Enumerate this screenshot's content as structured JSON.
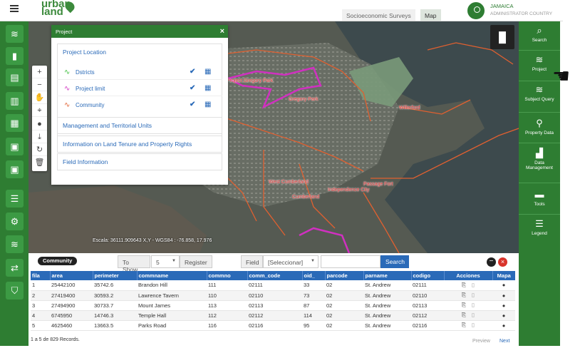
{
  "app": {
    "logo_line1": "urban",
    "logo_line2": "land"
  },
  "top_tabs": [
    {
      "label": "Socioeconomic Surveys"
    },
    {
      "label": "Map"
    }
  ],
  "user": {
    "country": "JAMAICA",
    "role": "ADMINISTRATOR COUNTRY"
  },
  "right_menu": [
    {
      "label": "Search",
      "icon": "search-icon"
    },
    {
      "label": "Project",
      "icon": "layers-icon"
    },
    {
      "label": "Subject Query",
      "icon": "layers-query-icon"
    },
    {
      "label": "Property Data",
      "icon": "pin-icon"
    },
    {
      "label": "Data Management",
      "icon": "bar-chart-icon"
    },
    {
      "label": "Tools",
      "icon": "toolbox-icon"
    },
    {
      "label": "Legend",
      "icon": "list-icon"
    }
  ],
  "project_panel": {
    "title": "Project",
    "section_location": "Project Location",
    "layers": [
      {
        "name": "Dstricts",
        "color": "#3bbf3b"
      },
      {
        "name": "Project limit",
        "color": "#d030c0"
      },
      {
        "name": "Community",
        "color": "#e06030"
      }
    ],
    "sections": [
      "Management and Territorial Units",
      "Information on Land Tenure and Property Rights",
      "Field Information"
    ]
  },
  "map": {
    "scale_text": "Escala: 36111.909643 X,Y - WGS84 : -76.858, 17.976",
    "labels": [
      "Project Gregory Park",
      "Gregory Park",
      "Willerford",
      "West Cumberland",
      "Cumberland",
      "Independence City",
      "Passage Fort"
    ]
  },
  "table_controls": {
    "badge": "Community",
    "to_show_label": "To Show",
    "to_show_value": "5",
    "register_label": "Register",
    "field_label": "Field",
    "field_value": "[Seleccionar]",
    "search_placeholder": "",
    "search_button": "Search"
  },
  "table": {
    "headers": [
      "fila",
      "area",
      "perimeter",
      "commname",
      "commno",
      "comm_code",
      "oid_",
      "parcode",
      "parname",
      "codigo",
      "Acciones",
      "Mapa"
    ],
    "rows": [
      [
        "1",
        "25442100",
        "35742.6",
        "Brandon Hill",
        "111",
        "02111",
        "33",
        "02",
        "St. Andrew",
        "02111"
      ],
      [
        "2",
        "27419400",
        "30593.2",
        "Lawrence Tavern",
        "110",
        "02110",
        "73",
        "02",
        "St. Andrew",
        "02110"
      ],
      [
        "3",
        "27494900",
        "30733.7",
        "Mount James",
        "113",
        "02113",
        "87",
        "02",
        "St. Andrew",
        "02113"
      ],
      [
        "4",
        "6745950",
        "14746.3",
        "Temple Hall",
        "112",
        "02112",
        "114",
        "02",
        "St. Andrew",
        "02112"
      ],
      [
        "5",
        "4625460",
        "13663.5",
        "Parks Road",
        "116",
        "02116",
        "95",
        "02",
        "St. Andrew",
        "02116"
      ]
    ],
    "footer": "1 a 5 de 829 Records.",
    "preview": "Preview",
    "next": "Next"
  },
  "colors": {
    "brand_green": "#2e7d32",
    "accent_blue": "#2a6ab8",
    "close_red": "#d9342b"
  }
}
